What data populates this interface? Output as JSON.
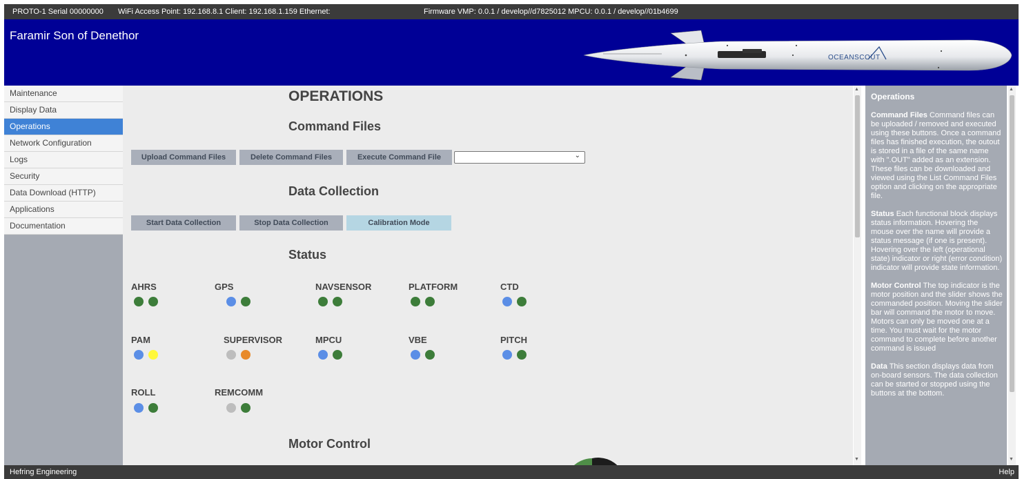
{
  "topbar": {
    "serial": "PROTO-1 Serial 00000000",
    "wifi": "WiFi Access Point: 192.168.8.1 Client: 192.168.1.159 Ethernet:",
    "firmware": "Firmware VMP: 0.0.1 / develop//d7825012 MPCU: 0.0.1 / develop//01b4699"
  },
  "banner": {
    "title": "Faramir Son of Denethor",
    "logo_text": "OCEANSCOUT",
    "background": "#000096"
  },
  "sidebar": {
    "items": [
      {
        "label": "Maintenance",
        "active": false
      },
      {
        "label": "Display Data",
        "active": false
      },
      {
        "label": "Operations",
        "active": true
      },
      {
        "label": "Network Configuration",
        "active": false
      },
      {
        "label": "Logs",
        "active": false
      },
      {
        "label": "Security",
        "active": false
      },
      {
        "label": "Data Download (HTTP)",
        "active": false
      },
      {
        "label": "Applications",
        "active": false
      },
      {
        "label": "Documentation",
        "active": false
      }
    ],
    "accent": "#3f82d6"
  },
  "main": {
    "title": "OPERATIONS",
    "command_files": {
      "heading": "Command Files",
      "upload_label": "Upload Command Files",
      "delete_label": "Delete Command Files",
      "execute_label": "Execute Command File",
      "select_value": ""
    },
    "data_collection": {
      "heading": "Data Collection",
      "start_label": "Start Data Collection",
      "stop_label": "Stop Data Collection",
      "calibration_label": "Calibration Mode"
    },
    "status": {
      "heading": "Status",
      "blocks": [
        {
          "name": "AHRS",
          "state": "green",
          "error": "green"
        },
        {
          "name": "GPS",
          "state": "blue",
          "error": "green"
        },
        {
          "name": "NAVSENSOR",
          "state": "green",
          "error": "green"
        },
        {
          "name": "PLATFORM",
          "state": "green",
          "error": "green"
        },
        {
          "name": "CTD",
          "state": "blue",
          "error": "green"
        },
        {
          "name": "PAM",
          "state": "blue",
          "error": "yellow"
        },
        {
          "name": "SUPERVISOR",
          "state": "grey",
          "error": "orange"
        },
        {
          "name": "MPCU",
          "state": "blue",
          "error": "green"
        },
        {
          "name": "VBE",
          "state": "blue",
          "error": "green"
        },
        {
          "name": "PITCH",
          "state": "blue",
          "error": "green"
        },
        {
          "name": "ROLL",
          "state": "blue",
          "error": "green"
        },
        {
          "name": "REMCOMM",
          "state": "grey",
          "error": "green"
        }
      ],
      "colors": {
        "green": "#3d7d3a",
        "blue": "#5b8ee6",
        "yellow": "#fff83a",
        "grey": "#bdbdbd",
        "orange": "#e88a2a",
        "dark_green": "#4f8050"
      }
    },
    "motor_control": {
      "heading": "Motor Control"
    }
  },
  "help": {
    "title": "Operations",
    "sections": [
      {
        "term": "Command Files",
        "text": "Command files can be uploaded / removed and executed using these buttons. Once a command files has finished execution, the outout is stored in a file of the same name with \".OUT\" added as an extension. These files can be downloaded and viewed using the List Command Files option and clicking on the appropriate file."
      },
      {
        "term": "Status",
        "text": "Each functional block displays status information. Hovering the mouse over the name will provide a status message (if one is present). Hovering over the left (operational state) indicator or right (error condition) indicator will provide state information."
      },
      {
        "term": "Motor Control",
        "text": "The top indicator is the motor position and the slider shows the commanded position. Moving the slider bar will command the motor to move. Motors can only be moved one at a time. You must wait for the motor command to complete before another command is issued"
      },
      {
        "term": "Data",
        "text": "This section displays data from on-board sensors. The data collection can be started or stopped using the buttons at the bottom."
      }
    ]
  },
  "footer": {
    "left": "Hefring Engineering",
    "right": "Help"
  }
}
